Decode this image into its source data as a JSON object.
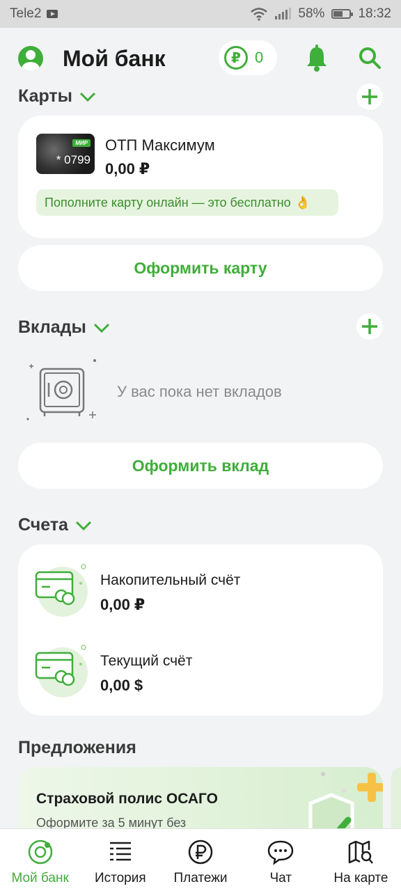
{
  "status_bar": {
    "carrier": "Tele2",
    "battery": "58%",
    "time": "18:32"
  },
  "header": {
    "title": "Мой банк",
    "bonus_count": "0",
    "bonus_symbol": "₽"
  },
  "cards_section": {
    "title": "Карты",
    "card": {
      "brand": "МИР",
      "number": "* 0799",
      "name": "ОТП Максимум",
      "balance": "0,00 ₽",
      "promo": "Пополните карту онлайн — это бесплатно",
      "promo_emoji": "👌"
    },
    "order_button": "Оформить карту"
  },
  "deposits_section": {
    "title": "Вклады",
    "empty_text": "У вас пока нет вкладов",
    "order_button": "Оформить вклад"
  },
  "accounts_section": {
    "title": "Счета",
    "accounts": [
      {
        "name": "Накопительный счёт",
        "amount": "0,00 ₽"
      },
      {
        "name": "Текущий счёт",
        "amount": "0,00 $"
      }
    ]
  },
  "offers_section": {
    "title": "Предложения",
    "offer": {
      "title": "Страховой полис ОСАГО",
      "subtitle": "Оформите за 5 минут без"
    }
  },
  "bottom_nav": {
    "items": [
      {
        "label": "Мой банк",
        "icon": "home-rings-icon",
        "active": true
      },
      {
        "label": "История",
        "icon": "history-list-icon",
        "active": false
      },
      {
        "label": "Платежи",
        "icon": "ruble-icon",
        "active": false
      },
      {
        "label": "Чат",
        "icon": "chat-icon",
        "active": false
      },
      {
        "label": "На карте",
        "icon": "map-search-icon",
        "active": false
      }
    ]
  },
  "colors": {
    "accent": "#3fae3a",
    "background": "#f2f3f5",
    "card": "#ffffff"
  }
}
